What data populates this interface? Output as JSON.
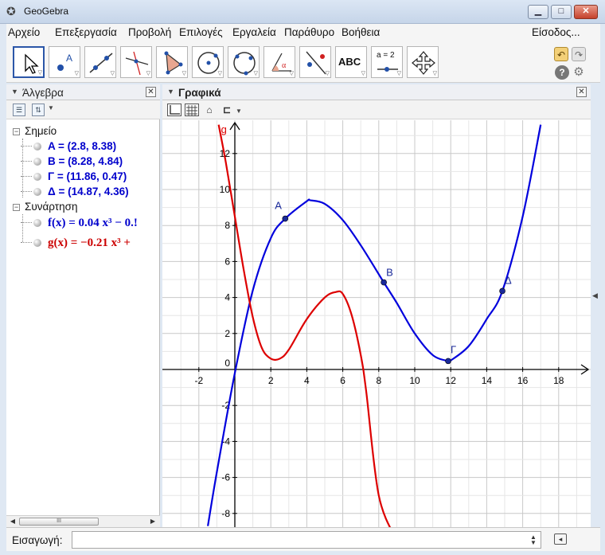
{
  "window": {
    "title": "GeoGebra",
    "minimize": "▁",
    "maximize": "□",
    "close": "✕"
  },
  "menu": {
    "items": [
      "Αρχείο",
      "Επεξεργασία",
      "Προβολή",
      "Επιλογές",
      "Εργαλεία",
      "Παράθυρο",
      "Βοήθεια"
    ],
    "signin": "Είσοδος..."
  },
  "toolbar": {
    "tools": [
      "move-tool",
      "point-tool",
      "line-tool",
      "perpendicular-line-tool",
      "polygon-tool",
      "circle-tool",
      "conic-tool",
      "angle-tool",
      "reflect-tool",
      "text-tool",
      "slider-tool",
      "move-view-tool"
    ],
    "text_tool_label": "ABC",
    "slider_tool_label": "a = 2",
    "undo": "↶",
    "redo": "↷",
    "help": "?",
    "settings": "⚙"
  },
  "algebra": {
    "title": "Άλγεβρα",
    "close": "✕",
    "categories": [
      {
        "name": "Σημείο",
        "toggle": "−"
      },
      {
        "name": "Συνάρτηση",
        "toggle": "−"
      }
    ],
    "points": [
      {
        "text": "A = (2.8, 8.38)",
        "color": "#0000cc"
      },
      {
        "text": "B = (8.28, 4.84)",
        "color": "#0000cc"
      },
      {
        "text": "Γ = (11.86, 0.47)",
        "color": "#0000cc"
      },
      {
        "text": "Δ = (14.87, 4.36)",
        "color": "#0000cc"
      }
    ],
    "functions": [
      {
        "name": "f(x)",
        "rhs": "= 0.04 x³ − 0.!",
        "color": "#0000cc"
      },
      {
        "name": "g(x)",
        "rhs": "= −0.21 x³ +",
        "color": "#cc0000"
      }
    ],
    "scroll_thumb": "III",
    "scroll_left": "◀",
    "scroll_right": "▶"
  },
  "graphics": {
    "title": "Γραφικά",
    "close": "✕",
    "x_ticks": [
      "-2",
      "2",
      "4",
      "6",
      "8",
      "10",
      "12",
      "14",
      "16",
      "18"
    ],
    "y_ticks_pos": [
      "12",
      "10",
      "8",
      "6",
      "4",
      "2"
    ],
    "y_ticks_neg": [
      "-2",
      "-4",
      "-6",
      "-8"
    ],
    "origin_label": "0",
    "point_labels": [
      "A",
      "B",
      "Γ",
      "Δ"
    ],
    "g_label": "g",
    "curve_f_color": "#0000dd",
    "curve_g_color": "#dd0000"
  },
  "chart_data": {
    "type": "line",
    "xlim": [
      -3.8,
      21.3
    ],
    "ylim": [
      -8.8,
      13.6
    ],
    "grid": true,
    "series": [
      {
        "name": "f",
        "color": "#0000dd",
        "x": [
          -1.5,
          -1,
          0,
          1,
          2,
          2.8,
          4,
          4.2,
          5,
          6,
          7,
          8.28,
          9,
          10,
          11,
          11.86,
          12,
          13,
          14,
          14.87,
          16,
          17
        ],
        "y": [
          -8.7,
          -5.7,
          -0.2,
          4.4,
          7.3,
          8.38,
          9.35,
          9.4,
          9.2,
          8.3,
          6.9,
          4.84,
          3.7,
          2.0,
          0.8,
          0.47,
          0.5,
          1.3,
          2.8,
          4.36,
          8.5,
          13.6
        ]
      },
      {
        "name": "g",
        "color": "#dd0000",
        "x": [
          -0.9,
          -0.5,
          0,
          0.5,
          1,
          1.5,
          2,
          2.5,
          3,
          4,
          5,
          5.6,
          6,
          6.5,
          7,
          7.3,
          8,
          9
        ],
        "y": [
          13.6,
          11.5,
          8.5,
          5.5,
          2.9,
          1.2,
          0.6,
          0.6,
          1.1,
          2.8,
          4.0,
          4.3,
          4.2,
          3.0,
          0.8,
          -1.2,
          -7.0,
          -9.5
        ]
      }
    ],
    "points": [
      {
        "label": "A",
        "x": 2.8,
        "y": 8.38
      },
      {
        "label": "B",
        "x": 8.28,
        "y": 4.84
      },
      {
        "label": "Γ",
        "x": 11.86,
        "y": 0.47
      },
      {
        "label": "Δ",
        "x": 14.87,
        "y": 4.36
      }
    ]
  },
  "input_bar": {
    "label": "Εισαγωγή:",
    "value": "",
    "placeholder": ""
  }
}
